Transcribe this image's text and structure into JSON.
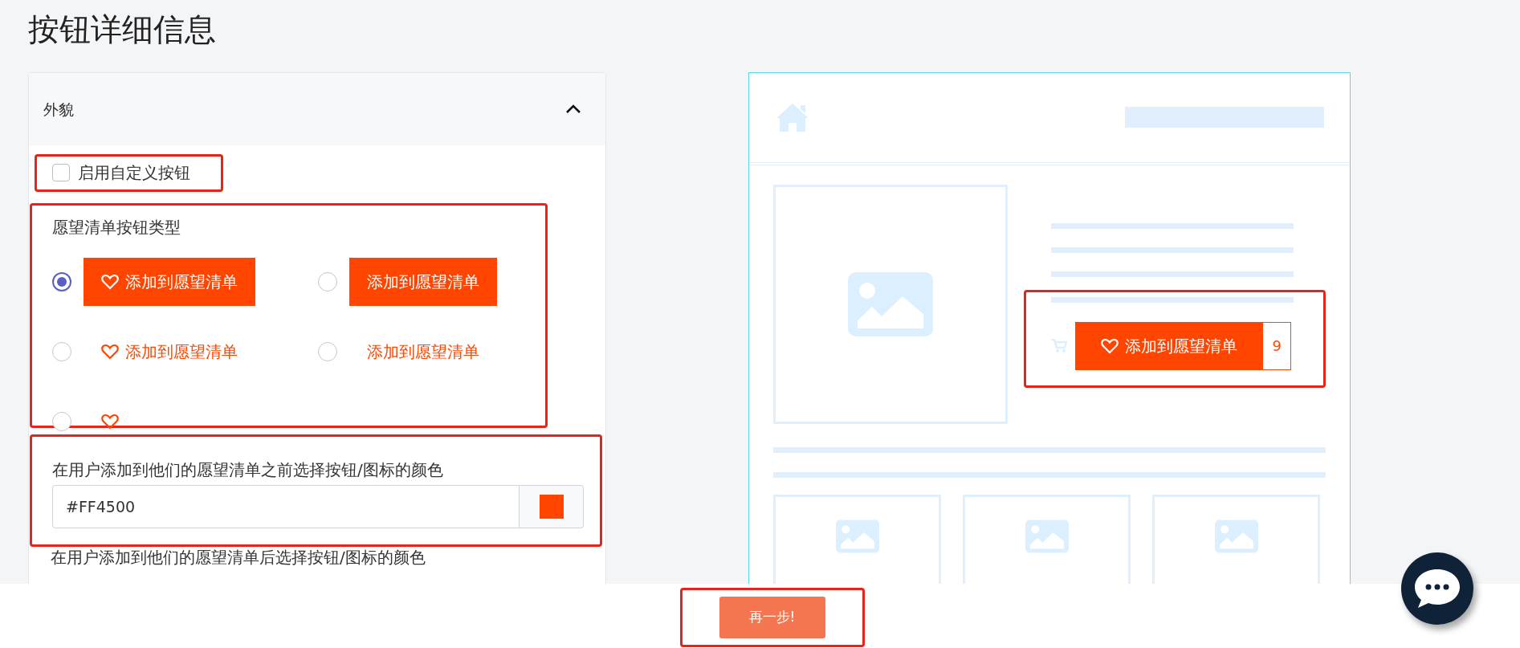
{
  "page_title": "按钮详细信息",
  "appearance_panel": {
    "title": "外貌",
    "expanded": true,
    "custom_button": {
      "label": "启用自定义按钮",
      "checked": false,
      "highlighted": true
    },
    "button_type": {
      "label": "愿望清单按钮类型",
      "highlighted": true,
      "options": [
        {
          "kind": "filled-icon",
          "text": "添加到愿望清单",
          "selected": true
        },
        {
          "kind": "filled",
          "text": "添加到愿望清单",
          "selected": false
        },
        {
          "kind": "text-icon",
          "text": "添加到愿望清单",
          "selected": false
        },
        {
          "kind": "text",
          "text": "添加到愿望清单",
          "selected": false
        },
        {
          "kind": "icon",
          "selected": false
        }
      ]
    },
    "color_before": {
      "label": "在用户添加到他们的愿望清单之前选择按钮/图标的颜色",
      "value": "#FF4500",
      "highlighted": true
    },
    "color_after": {
      "label": "在用户添加到他们的愿望清单后选择按钮/图标的颜色"
    }
  },
  "preview": {
    "wishlist_button": {
      "text": "添加到愿望清单",
      "count": "9",
      "highlighted": true
    }
  },
  "footer": {
    "next_button": {
      "text": "再一步!",
      "highlighted": true
    }
  }
}
